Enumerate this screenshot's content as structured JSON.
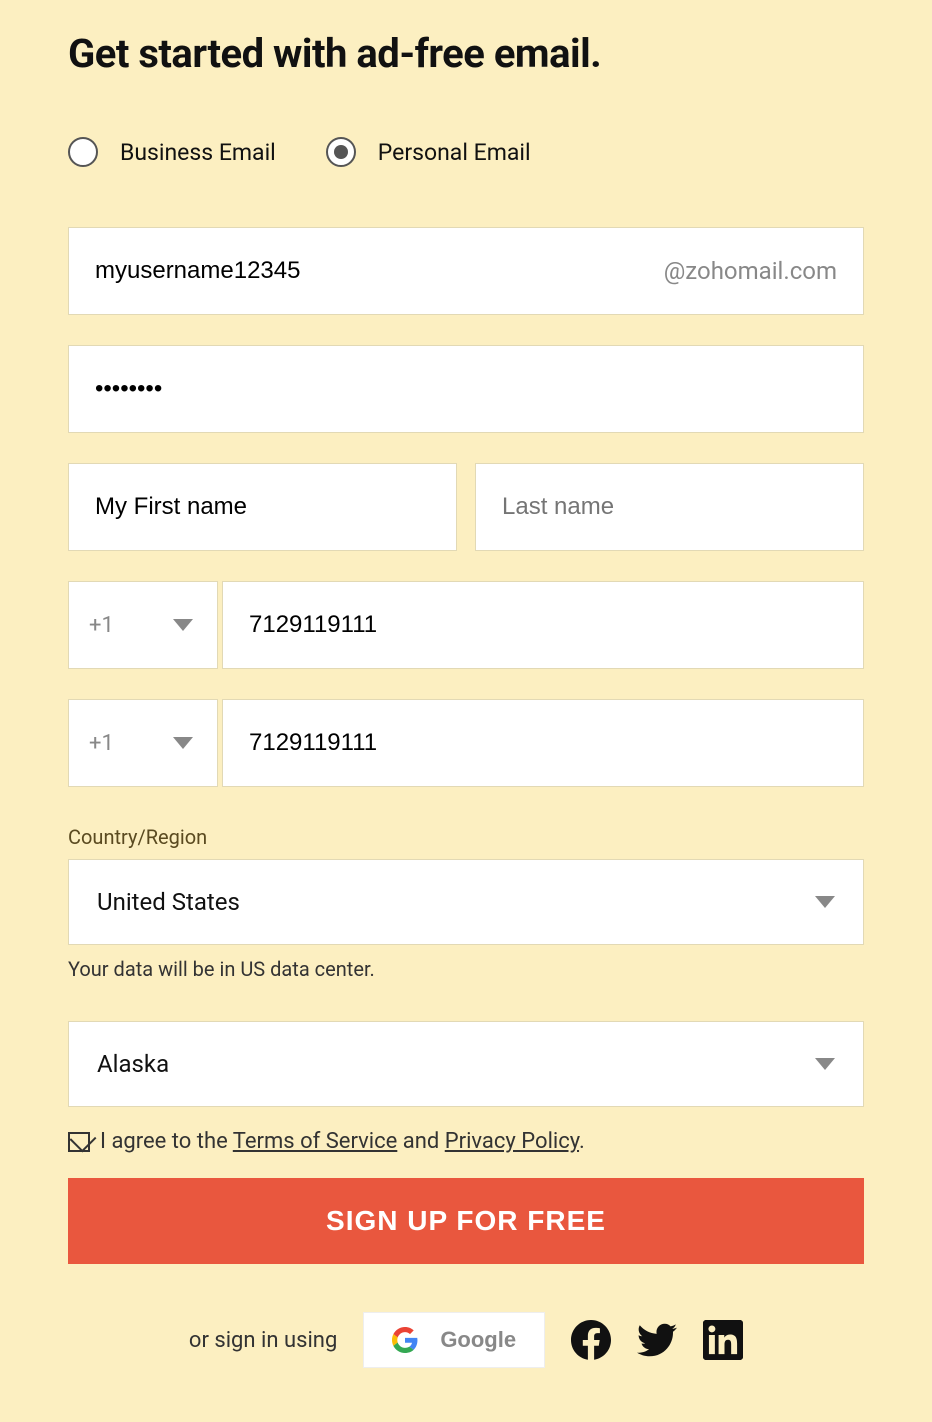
{
  "heading": "Get started with ad-free email.",
  "email_type": {
    "business_label": "Business Email",
    "personal_label": "Personal Email",
    "selected": "personal"
  },
  "username": {
    "value": "myusername12345",
    "suffix": "@zohomail.com"
  },
  "password": {
    "value": "••••••••"
  },
  "first_name": {
    "value": "My First name"
  },
  "last_name": {
    "placeholder": "Last name"
  },
  "phone1": {
    "code": "+1",
    "value": "7129119111"
  },
  "phone2": {
    "code": "+1",
    "value": "7129119111"
  },
  "country": {
    "label": "Country/Region",
    "value": "United States",
    "helper": "Your data will be in US data center."
  },
  "state": {
    "value": "Alaska"
  },
  "agree": {
    "prefix": "I agree to the ",
    "tos": "Terms of Service",
    "mid": " and ",
    "privacy": "Privacy Policy",
    "suffix": "."
  },
  "signup_button": "SIGN UP FOR FREE",
  "social": {
    "prefix": "or sign in using",
    "google": "Google"
  }
}
